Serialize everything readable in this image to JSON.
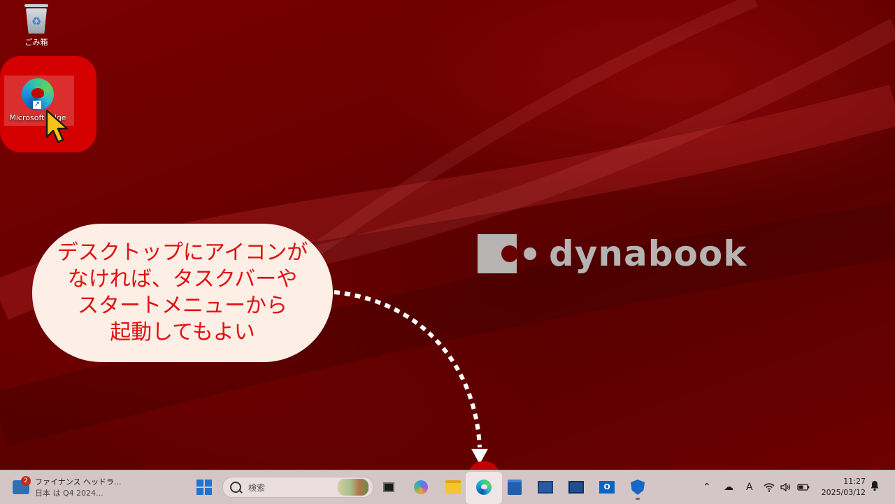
{
  "desktop": {
    "recycle_bin_label": "ごみ箱",
    "edge_icon_label": "Microsoft Edge",
    "logo_text": "dynabook",
    "callout_lines": [
      "デスクトップにアイコンが",
      "なければ、タスクバーや",
      "スタートメニューから",
      "起動してもよい"
    ]
  },
  "taskbar": {
    "widget": {
      "badge": "2",
      "title": "ファイナンス ヘッドラ...",
      "subtitle": "日本 は Q4 2024..."
    },
    "search": {
      "placeholder": "検索"
    },
    "pinned_apps": [
      "start",
      "task-view",
      "copilot",
      "file-explorer",
      "microsoft-edge",
      "microsoft-store",
      "app",
      "app",
      "outlook",
      "windows-security"
    ],
    "tray": {
      "ime": "A",
      "time": "11:27",
      "date": "2025/03/12"
    }
  },
  "colors": {
    "callout_bg": "#fdeee6",
    "callout_text": "#e01010",
    "highlight": "#d40000",
    "taskbar_bg": "#d4c6c6"
  }
}
